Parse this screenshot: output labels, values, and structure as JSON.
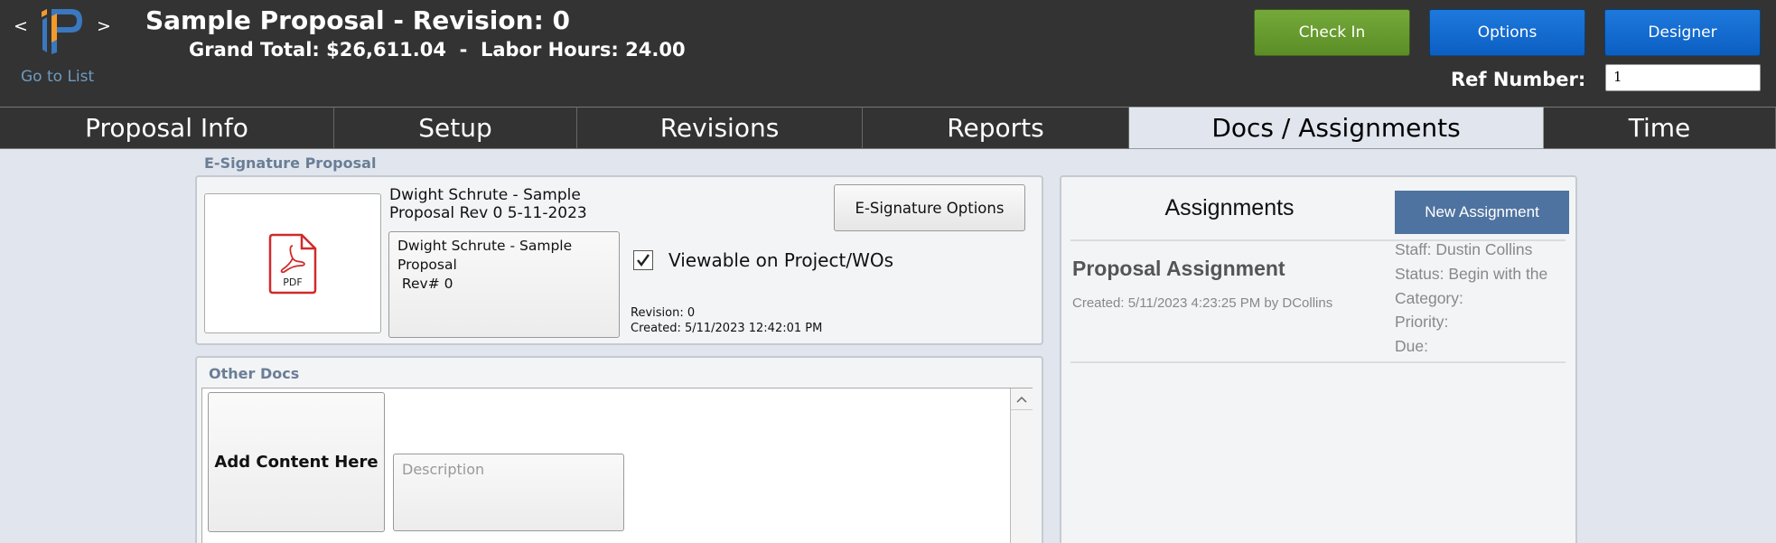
{
  "header": {
    "prev_arrow": "<",
    "next_arrow": ">",
    "go_to_list": "Go to List",
    "title": "Sample Proposal - Revision: 0",
    "subtitle": "Grand Total: $26,611.04  -  Labor Hours: 24.00",
    "buttons": {
      "check_in": "Check In",
      "options": "Options",
      "designer": "Designer"
    },
    "ref_number_label": "Ref Number:",
    "ref_number_value": "1",
    "colors": {
      "bar": "#333333",
      "check_in": "#6a9f30",
      "options": "#1565c0",
      "link": "#6e9bc0"
    }
  },
  "tabs": [
    {
      "label": "Proposal Info",
      "active": false
    },
    {
      "label": "Setup",
      "active": false
    },
    {
      "label": "Revisions",
      "active": false
    },
    {
      "label": "Reports",
      "active": false
    },
    {
      "label": "Docs / Assignments",
      "active": true
    },
    {
      "label": "Time",
      "active": false
    }
  ],
  "esignature": {
    "heading": "E-Signature Proposal",
    "pdf_icon_label": "PDF",
    "document_name": "Dwight Schrute - Sample Proposal Rev 0 5-11-2023",
    "description_lines": [
      "Dwight Schrute - Sample",
      "Proposal",
      " Rev# 0"
    ],
    "options_button": "E-Signature Options",
    "viewable_label": "Viewable on Project/WOs",
    "viewable_checked": true,
    "revision_line": "Revision: 0",
    "created_line": "Created: 5/11/2023 12:42:01 PM"
  },
  "other_docs": {
    "heading": "Other Docs",
    "add_content": "Add Content Here",
    "description_placeholder": "Description"
  },
  "assignments": {
    "title": "Assignments",
    "new_button": "New Assignment",
    "button_color": "#4f73a0",
    "items": [
      {
        "name": "Proposal Assignment",
        "created": "Created: 5/11/2023 4:23:25 PM by DCollins",
        "staff": "Staff: Dustin Collins",
        "status": "Status: Begin with the",
        "category": "Category:",
        "priority": "Priority:",
        "due": "Due:"
      }
    ]
  }
}
